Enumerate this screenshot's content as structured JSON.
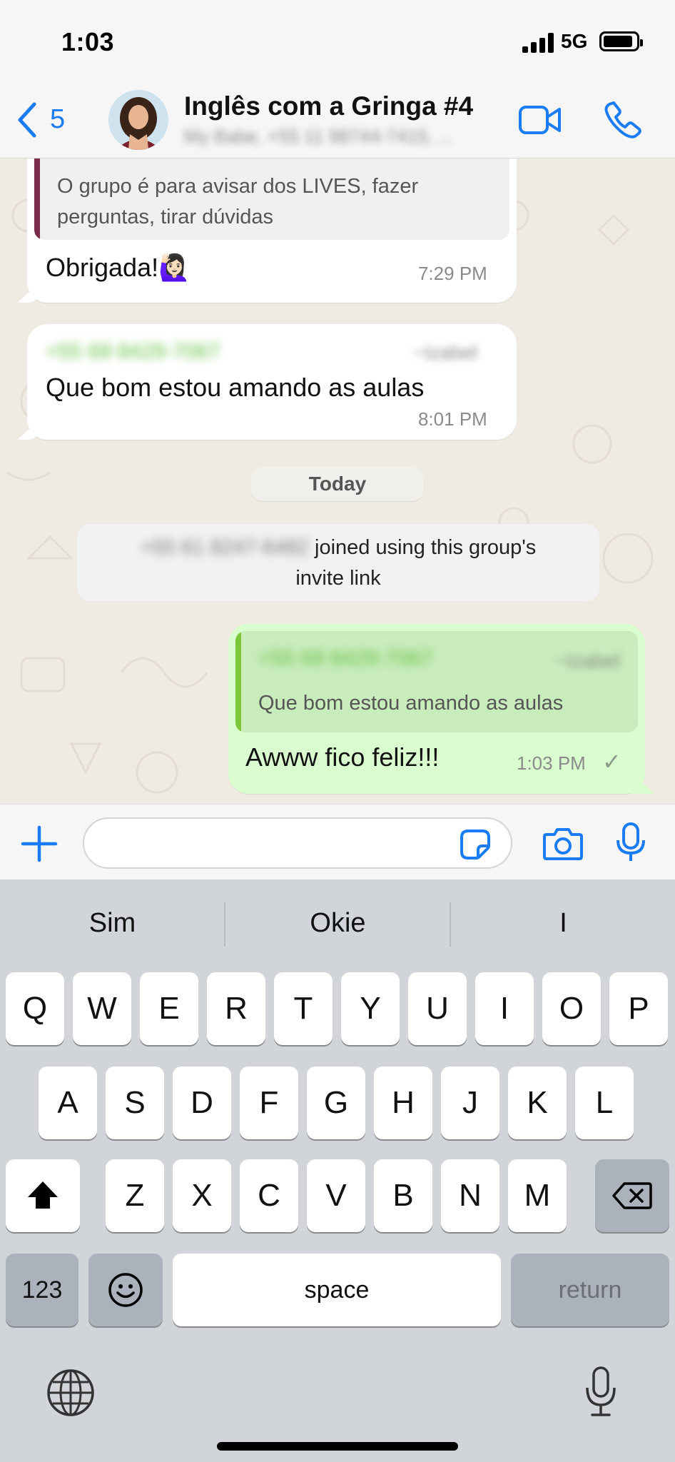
{
  "status_bar": {
    "time": "1:03",
    "network": "5G"
  },
  "header": {
    "back_count": "5",
    "chat_title": "Inglês com a Gringa #4",
    "chat_subtitle": "My Babe, +55 11 98744-7415, ..."
  },
  "messages": [
    {
      "quote_text": "O grupo é para avisar dos LIVES, fazer perguntas, tirar dúvidas",
      "text": "Obrigada!🙋🏻‍♀️",
      "time": "7:29 PM"
    },
    {
      "sender": "+55 69 8429-7067",
      "sender_alias": "~Izabel",
      "text": "Que bom estou amando as aulas",
      "time": "8:01 PM"
    }
  ],
  "date_divider": "Today",
  "system_message": {
    "number": "+55 61 8247-6482",
    "text": "joined using this group's",
    "text2": "invite link"
  },
  "outgoing": {
    "quote_sender": "+55 69 8429-7067",
    "quote_alias": "~Izabel",
    "quote_text": "Que bom estou amando as aulas",
    "text": "Awww fico feliz!!!",
    "time": "1:03 PM",
    "status": "✓"
  },
  "input": {
    "placeholder": ""
  },
  "keyboard": {
    "suggestions": [
      "Sim",
      "Okie",
      "I"
    ],
    "row1": [
      "Q",
      "W",
      "E",
      "R",
      "T",
      "Y",
      "U",
      "I",
      "O",
      "P"
    ],
    "row2": [
      "A",
      "S",
      "D",
      "F",
      "G",
      "H",
      "J",
      "K",
      "L"
    ],
    "row3": [
      "Z",
      "X",
      "C",
      "V",
      "B",
      "N",
      "M"
    ],
    "numbers_key": "123",
    "space_key": "space",
    "return_key": "return"
  },
  "colors": {
    "accent": "#1a7cf5",
    "outgoing_bubble": "#dafdcf",
    "quote_bar_in": "#7b2c4a",
    "quote_bar_out": "#7cc63a"
  }
}
